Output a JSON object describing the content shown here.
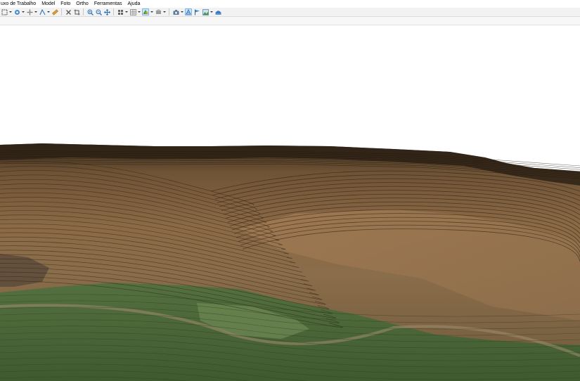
{
  "menu": [
    "uxo de Trabalho",
    "Model",
    "Foto",
    "Ortho",
    "Ferramentas",
    "Ajuda"
  ],
  "toolbar_icons": [
    "select-rect-icon",
    "rotate-icon",
    "navigate-icon",
    "ruler-icon",
    "measure-icon",
    "delete-icon",
    "crop-icon",
    "zoom-in-icon",
    "zoom-out-icon",
    "move-icon",
    "grid-icon",
    "grid-alt-icon",
    "texture-icon",
    "solid-icon",
    "camera-icon",
    "shading-icon",
    "flag-icon",
    "image-icon",
    "dem-icon"
  ],
  "colors": {
    "sky": "#ffffff",
    "terrain_brown": "#8a6a45",
    "terrain_dark": "#3a2a1a",
    "vegetation": "#4f6a3a",
    "toolbar_bg": "#f2f2f2"
  }
}
